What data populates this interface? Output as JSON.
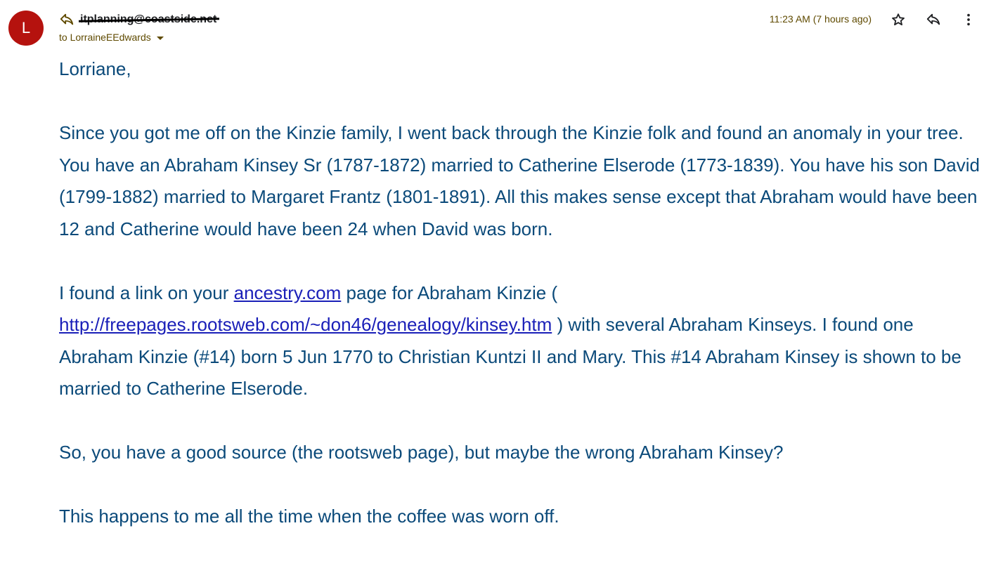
{
  "header": {
    "avatar_letter": "L",
    "sender_email": "itplanning@coastside.net",
    "to_label": "to LorraineEEdwards",
    "timestamp": "11:23 AM (7 hours ago)",
    "icons": {
      "sender_reply": "reply-arrow-icon",
      "star": "star-icon",
      "reply": "reply-icon",
      "more": "more-vertical-icon"
    },
    "colors": {
      "avatar_bg": "#b5120e",
      "meta_text": "#5f4a00"
    }
  },
  "body": {
    "greeting": "Lorriane,",
    "p1": "Since you got me off on the Kinzie family, I went back through the Kinzie folk and found an anomaly in your tree.  You have an Abraham Kinsey Sr (1787-1872) married to Catherine Elserode (1773-1839).  You have his son David (1799-1882) married to Margaret Frantz (1801-1891).  All this makes sense except that Abraham would have been 12 and Catherine would have been 24 when David was born.",
    "p2_a": "I found a link on your ",
    "p2_link1": "ancestry.com",
    "p2_b": " page for Abraham Kinzie ( ",
    "p2_link2": "http://freepages.rootsweb.com/~don46/genealogy/kinsey.htm",
    "p2_c": " ) with several Abraham Kinseys.  I found one Abraham Kinzie (#14) born 5 Jun 1770 to Christian Kuntzi II and Mary.  This #14 Abraham Kinsey is shown to be married to Catherine Elserode.",
    "p3": "So, you have a good source (the rootsweb page), but maybe the wrong Abraham Kinsey?",
    "p4": "This happens to me all the time when the coffee was worn off.",
    "colors": {
      "text": "#0b4a7a",
      "link": "#1a1fb8"
    }
  }
}
